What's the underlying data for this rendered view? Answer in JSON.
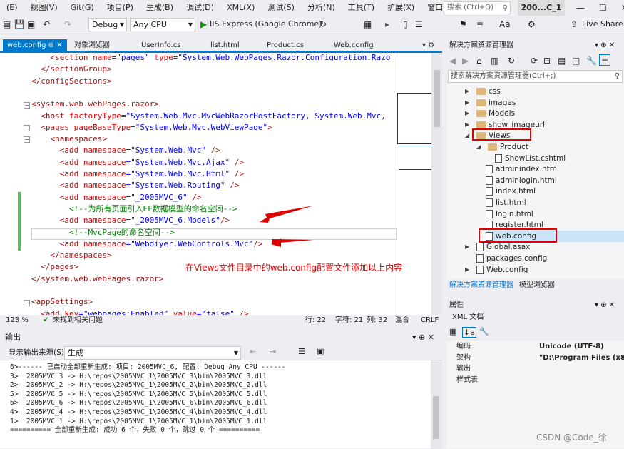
{
  "menu": [
    "(E)",
    "视图(V)",
    "Git(G)",
    "项目(P)",
    "生成(B)",
    "调试(D)",
    "XML(X)",
    "测试(S)",
    "分析(N)",
    "工具(T)",
    "扩展(X)",
    "窗口(W)",
    "帮助(H)"
  ],
  "search_placeholder": "搜索 (Ctrl+Q)",
  "solution_name": "200...C_1",
  "window_buttons": [
    "—",
    "☐",
    "✕"
  ],
  "toolbar": {
    "config": "Debug",
    "platform": "Any CPU",
    "run_label": "IIS Express (Google Chrome)",
    "live_share": "Live Share"
  },
  "tabs": {
    "active": "web.config",
    "items": [
      "对象浏览器",
      "UserInfo.cs",
      "list.html",
      "Product.cs",
      "Web.config"
    ]
  },
  "code_lines": [
    [
      [
        "t",
        "    <section "
      ],
      [
        "a",
        "name"
      ],
      [
        "p",
        "="
      ],
      [
        "v",
        "\"pages\""
      ],
      [
        "t",
        " "
      ],
      [
        "a",
        "type"
      ],
      [
        "p",
        "="
      ],
      [
        "v",
        "\"System.Web.WebPages.Razor.Configuration.Razo"
      ]
    ],
    [
      [
        "t",
        "  </sectionGroup>"
      ]
    ],
    [
      [
        "t",
        "</configSections>"
      ]
    ],
    [
      [
        "t",
        ""
      ]
    ],
    [
      [
        "t",
        "<system.web.webPages.razor>"
      ]
    ],
    [
      [
        "t",
        "  <host "
      ],
      [
        "a",
        "factoryType"
      ],
      [
        "p",
        "="
      ],
      [
        "v",
        "\"System.Web.Mvc.MvcWebRazorHostFactory, System.Web.Mvc,"
      ]
    ],
    [
      [
        "t",
        "  <pages "
      ],
      [
        "a",
        "pageBaseType"
      ],
      [
        "p",
        "="
      ],
      [
        "v",
        "\"System.Web.Mvc.WebViewPage\""
      ],
      [
        "t",
        ">"
      ]
    ],
    [
      [
        "t",
        "    <namespaces>"
      ]
    ],
    [
      [
        "t",
        "      <add "
      ],
      [
        "a",
        "namespace"
      ],
      [
        "p",
        "="
      ],
      [
        "v",
        "\"System.Web.Mvc\""
      ],
      [
        "t",
        " />"
      ]
    ],
    [
      [
        "t",
        "      <add "
      ],
      [
        "a",
        "namespace"
      ],
      [
        "p",
        "="
      ],
      [
        "v",
        "\"System.Web.Mvc.Ajax\""
      ],
      [
        "t",
        " />"
      ]
    ],
    [
      [
        "t",
        "      <add "
      ],
      [
        "a",
        "namespace"
      ],
      [
        "p",
        "="
      ],
      [
        "v",
        "\"System.Web.Mvc.Html\""
      ],
      [
        "t",
        " />"
      ]
    ],
    [
      [
        "t",
        "      <add "
      ],
      [
        "a",
        "namespace"
      ],
      [
        "p",
        "="
      ],
      [
        "v",
        "\"System.Web.Routing\""
      ],
      [
        "t",
        " />"
      ]
    ],
    [
      [
        "t",
        "      <add "
      ],
      [
        "a",
        "namespace"
      ],
      [
        "p",
        "="
      ],
      [
        "v",
        "\"_2005MVC_6\""
      ],
      [
        "t",
        " />"
      ]
    ],
    [
      [
        "c",
        "        <!--为所有页面引入EF数据模型的命名空间-->"
      ]
    ],
    [
      [
        "t",
        "      <add "
      ],
      [
        "a",
        "namespace"
      ],
      [
        "p",
        "="
      ],
      [
        "v",
        "\"_2005MVC_6.Models\""
      ],
      [
        "t",
        "/>"
      ]
    ],
    [
      [
        "c",
        "        <!--MvcPage的命名空间-->"
      ]
    ],
    [
      [
        "t",
        "      <add "
      ],
      [
        "a",
        "namespace"
      ],
      [
        "p",
        "="
      ],
      [
        "v",
        "\"Webdiyer.WebControls.Mvc\""
      ],
      [
        "t",
        "/>"
      ]
    ],
    [
      [
        "t",
        "    </namespaces>"
      ]
    ],
    [
      [
        "t",
        "  </pages>"
      ]
    ],
    [
      [
        "t",
        "</system.web.webPages.razor>"
      ]
    ],
    [
      [
        "t",
        ""
      ]
    ],
    [
      [
        "t",
        "<appSettings>"
      ]
    ],
    [
      [
        "t",
        "  <add "
      ],
      [
        "a",
        "key"
      ],
      [
        "p",
        "="
      ],
      [
        "v",
        "\"webpages:Enabled\""
      ],
      [
        "t",
        " "
      ],
      [
        "a",
        "value"
      ],
      [
        "p",
        "="
      ],
      [
        "v",
        "\"false\""
      ],
      [
        "t",
        " />"
      ]
    ]
  ],
  "annotation": "在Views文件目录中的web.config配置文件添加以上内容",
  "status": {
    "zoom": "123 %",
    "issues": "未找到相关问题",
    "line": "行: 22",
    "char": "字符: 21",
    "col": "列: 32",
    "mix": "混合",
    "eol": "CRLF"
  },
  "output": {
    "title": "输出",
    "source_label": "显示输出来源(S):",
    "source_value": "生成",
    "lines": [
      "6>------ 已启动全部重新生成: 项目: 2005MVC_6, 配置: Debug Any CPU ------",
      "3>  2005MVC_3 -> H:\\repos\\2005MVC_1\\2005MVC_3\\bin\\2005MVC_3.dll",
      "2>  2005MVC_2 -> H:\\repos\\2005MVC_1\\2005MVC_2\\bin\\2005MVC_2.dll",
      "5>  2005MVC_5 -> H:\\repos\\2005MVC_1\\2005MVC_5\\bin\\2005MVC_5.dll",
      "6>  2005MVC_6 -> H:\\repos\\2005MVC_1\\2005MVC_6\\bin\\2005MVC_6.dll",
      "4>  2005MVC_4 -> H:\\repos\\2005MVC_1\\2005MVC_4\\bin\\2005MVC_4.dll",
      "1>  2005MVC_1 -> H:\\repos\\2005MVC_1\\2005MVC_1\\bin\\2005MVC_1.dll",
      "========== 全部重新生成: 成功 6 个，失败 0 个，跳过 0 个 =========="
    ]
  },
  "solution_explorer": {
    "title": "解决方案资源管理器",
    "search": "搜索解决方案资源管理器(Ctrl+;)",
    "items": [
      {
        "label": "css",
        "kind": "folder",
        "arrow": "▶"
      },
      {
        "label": "images",
        "kind": "folder",
        "arrow": "▶"
      },
      {
        "label": "Models",
        "kind": "folder",
        "arrow": "▶"
      },
      {
        "label": "show_imageurl",
        "kind": "folder",
        "arrow": "▶"
      },
      {
        "label": "Views",
        "kind": "folder",
        "arrow": "◢"
      },
      {
        "label": "Product",
        "kind": "folder",
        "arrow": "◢"
      },
      {
        "label": "ShowList.cshtml",
        "kind": "file",
        "arrow": ""
      },
      {
        "label": "adminindex.html",
        "kind": "file",
        "arrow": ""
      },
      {
        "label": "adminlogin.html",
        "kind": "file",
        "arrow": ""
      },
      {
        "label": "index.html",
        "kind": "file",
        "arrow": ""
      },
      {
        "label": "list.html",
        "kind": "file",
        "arrow": ""
      },
      {
        "label": "login.html",
        "kind": "file",
        "arrow": ""
      },
      {
        "label": "register.html",
        "kind": "file",
        "arrow": ""
      },
      {
        "label": "web.config",
        "kind": "file",
        "arrow": ""
      },
      {
        "label": "Global.asax",
        "kind": "file",
        "arrow": "▶"
      },
      {
        "label": "packages.config",
        "kind": "file",
        "arrow": ""
      },
      {
        "label": "Web.config",
        "kind": "file",
        "arrow": "▶"
      }
    ],
    "tabs": [
      "解决方案资源管理器",
      "模型浏览器"
    ]
  },
  "properties": {
    "title": "属性",
    "subject": "XML 文档",
    "rows": [
      [
        "编码",
        "Unicode (UTF-8)"
      ],
      [
        "架构",
        "\"D:\\Program Files (x86)"
      ],
      [
        "输出",
        ""
      ],
      [
        "样式表",
        ""
      ]
    ]
  },
  "watermark": "CSDN @Code_徐"
}
